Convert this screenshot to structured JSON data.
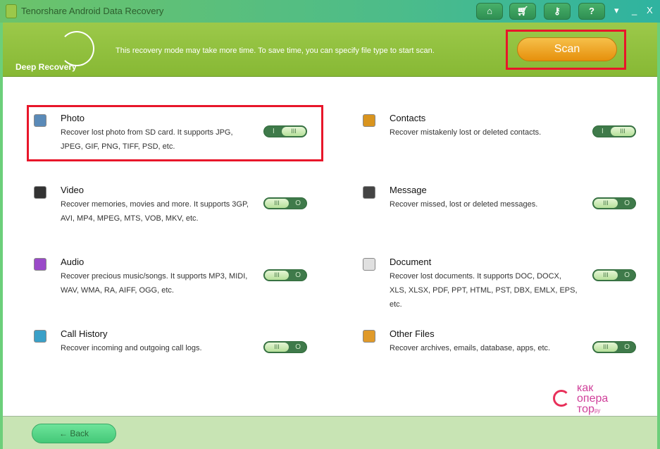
{
  "window": {
    "title": "Tenorshare Android Data Recovery",
    "buttons": [
      "home-icon",
      "cart-icon",
      "key-icon",
      "help-icon"
    ],
    "help_label": "?",
    "menu": "▾",
    "minimize": "_",
    "close": "X"
  },
  "header": {
    "mode": "Deep Recovery",
    "hint": "This recovery mode may take more time. To save time, you can specify file type to start scan.",
    "scan_label": "Scan"
  },
  "items": [
    {
      "name": "Photo",
      "desc": "Recover lost photo from SD card. It supports JPG, JPEG, GIF, PNG, TIFF, PSD, etc.",
      "on": true,
      "icon": "photo-icon",
      "color": "#5a8ab8"
    },
    {
      "name": "Contacts",
      "desc": "Recover mistakenly lost or deleted contacts.",
      "on": true,
      "icon": "contacts-icon",
      "color": "#d9941e"
    },
    {
      "name": "Video",
      "desc": "Recover memories, movies and more. It supports 3GP, AVI, MP4, MPEG, MTS, VOB, MKV, etc.",
      "on": false,
      "icon": "video-icon",
      "color": "#333333"
    },
    {
      "name": "Message",
      "desc": "Recover missed, lost or deleted messages.",
      "on": false,
      "icon": "message-icon",
      "color": "#444444"
    },
    {
      "name": "Audio",
      "desc": "Recover precious music/songs. It supports MP3, MIDI, WAV, WMA, RA, AIFF, OGG, etc.",
      "on": false,
      "icon": "audio-icon",
      "color": "#9a4ac8"
    },
    {
      "name": "Document",
      "desc": "Recover lost documents. It supports DOC, DOCX, XLS, XLSX, PDF, PPT, HTML, PST, DBX, EMLX, EPS, etc.",
      "on": false,
      "icon": "document-icon",
      "color": "#e0e0e0"
    },
    {
      "name": "Call History",
      "desc": "Recover incoming and outgoing call logs.",
      "on": false,
      "icon": "call-history-icon",
      "color": "#3aa0c8"
    },
    {
      "name": "Other Files",
      "desc": "Recover archives, emails, database, apps, etc.",
      "on": false,
      "icon": "other-files-icon",
      "color": "#e09a2a"
    }
  ],
  "toggle": {
    "on_mark": "I",
    "off_mark": "O",
    "knob": "III"
  },
  "footer": {
    "back_label": "Back",
    "back_arrow": "←"
  },
  "watermark": {
    "line1": "как",
    "line2": "опера",
    "line3": "тор",
    "suffix": "ру"
  }
}
